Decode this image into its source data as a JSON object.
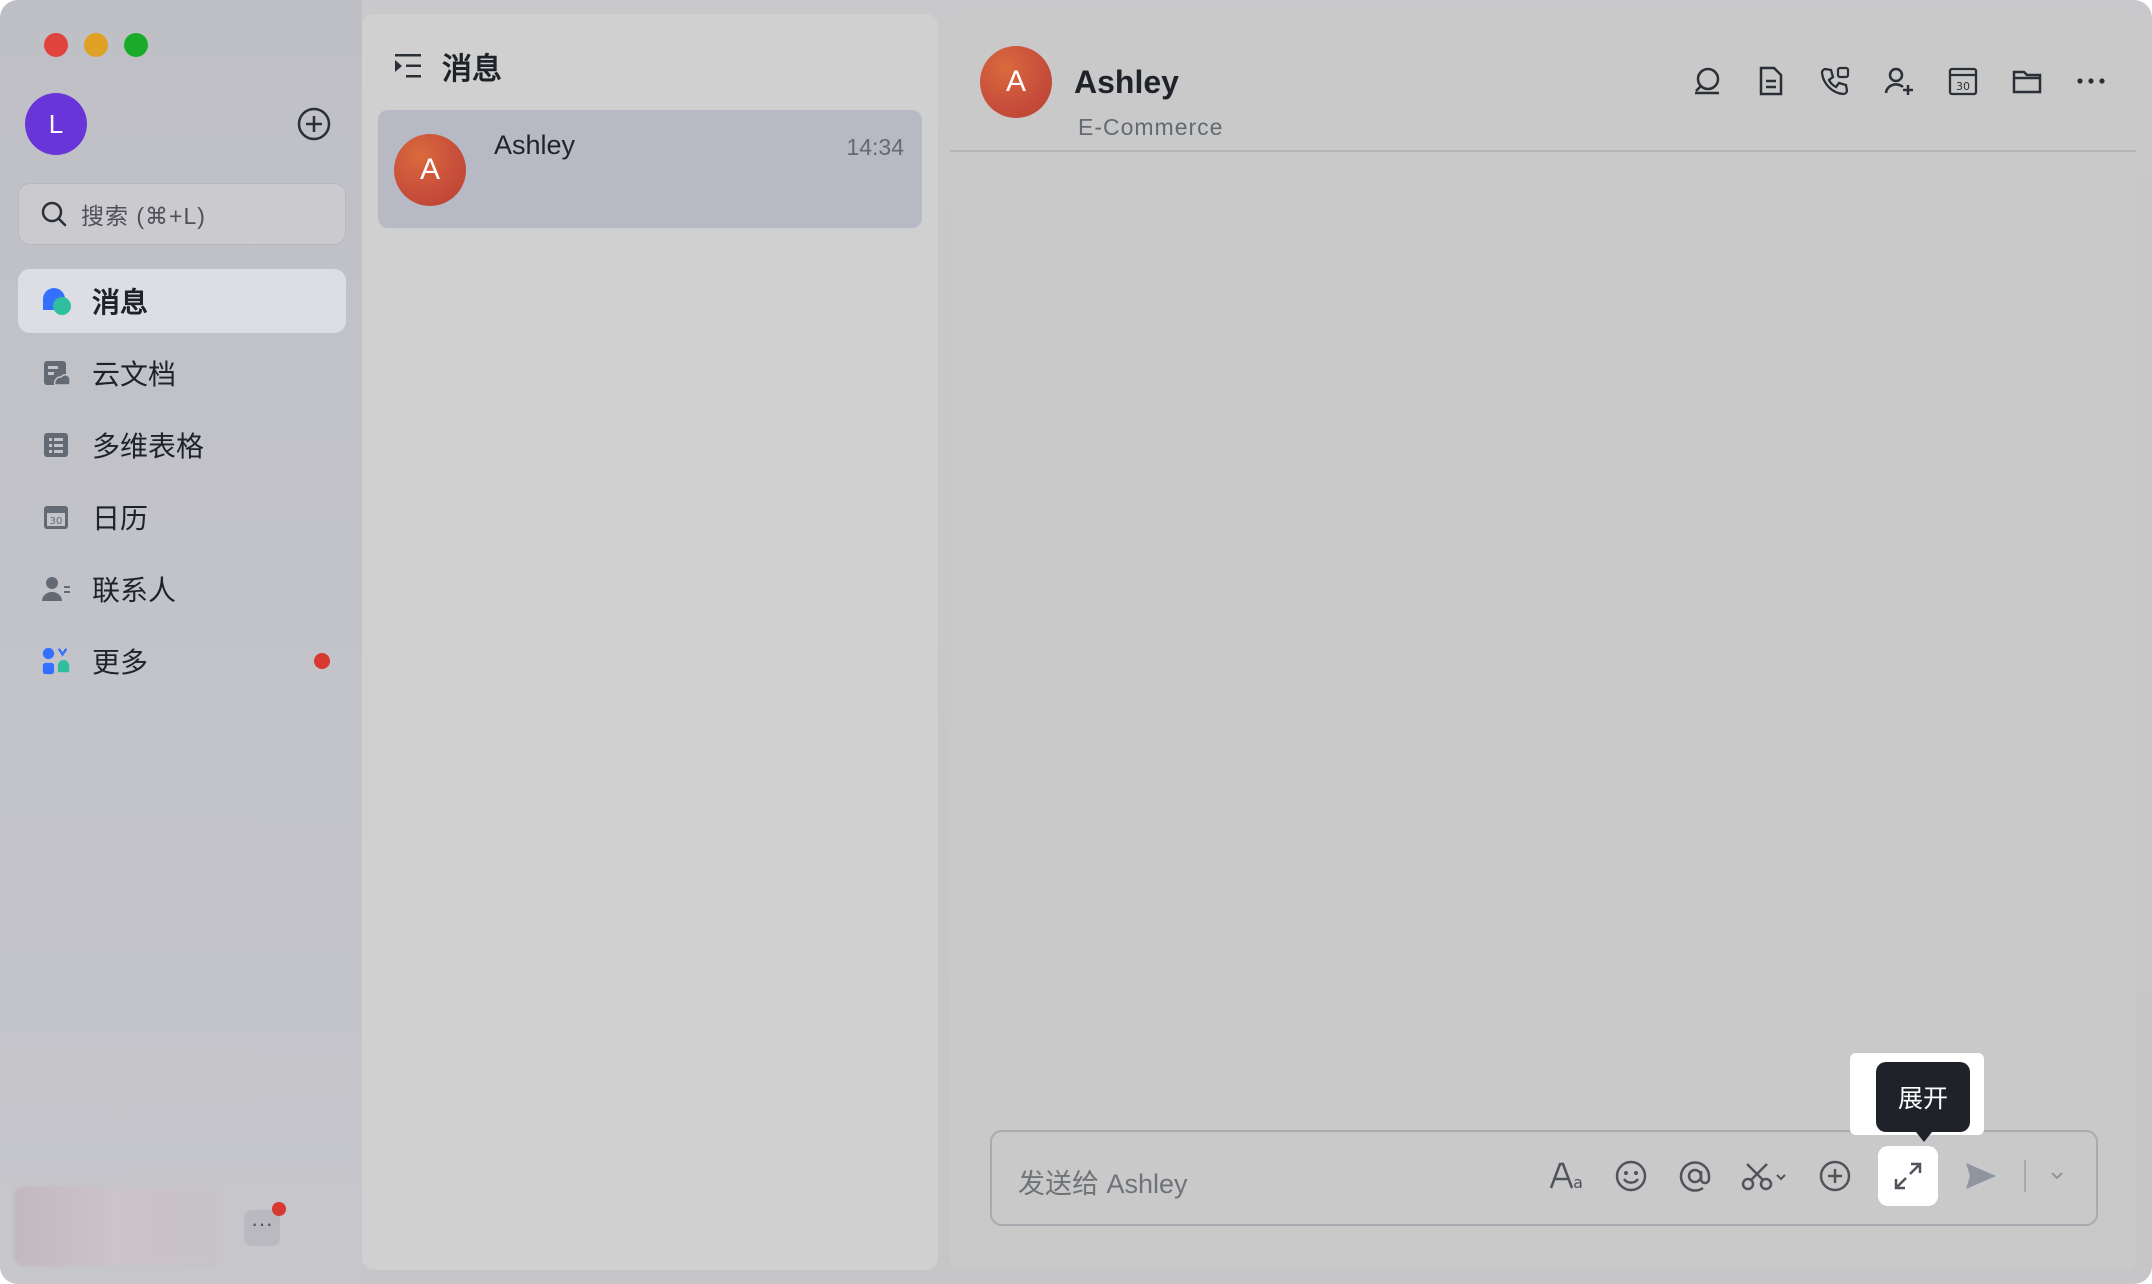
{
  "sidebar": {
    "user_avatar_letter": "L",
    "search_placeholder": "搜索 (⌘+L)",
    "nav": [
      {
        "label": "消息",
        "icon": "chat-bubbles-icon"
      },
      {
        "label": "云文档",
        "icon": "cloud-doc-icon"
      },
      {
        "label": "多维表格",
        "icon": "base-table-icon"
      },
      {
        "label": "日历",
        "icon": "calendar-icon"
      },
      {
        "label": "联系人",
        "icon": "contacts-icon"
      },
      {
        "label": "更多",
        "icon": "apps-icon"
      }
    ],
    "more_button": "···"
  },
  "chatlist": {
    "title": "消息",
    "items": [
      {
        "avatar_letter": "A",
        "name": "Ashley",
        "time": "14:34"
      }
    ]
  },
  "conversation": {
    "avatar_letter": "A",
    "name": "Ashley",
    "subtitle": "E-Commerce",
    "header_icons": [
      "search-chat-icon",
      "doc-icon",
      "phone-call-icon",
      "add-member-icon",
      "calendar-icon",
      "folder-icon",
      "more-icon"
    ],
    "composer_placeholder": "发送给 Ashley",
    "tools": [
      "text-format-icon",
      "emoji-icon",
      "mention-icon",
      "screenshot-icon",
      "add-icon",
      "expand-icon",
      "send-icon",
      "send-options-icon"
    ],
    "tooltip": "展开"
  },
  "colors": {
    "user_avatar": "#6a35d8",
    "contact_avatar": "#c84f3b",
    "notification_dot": "#d83931"
  }
}
